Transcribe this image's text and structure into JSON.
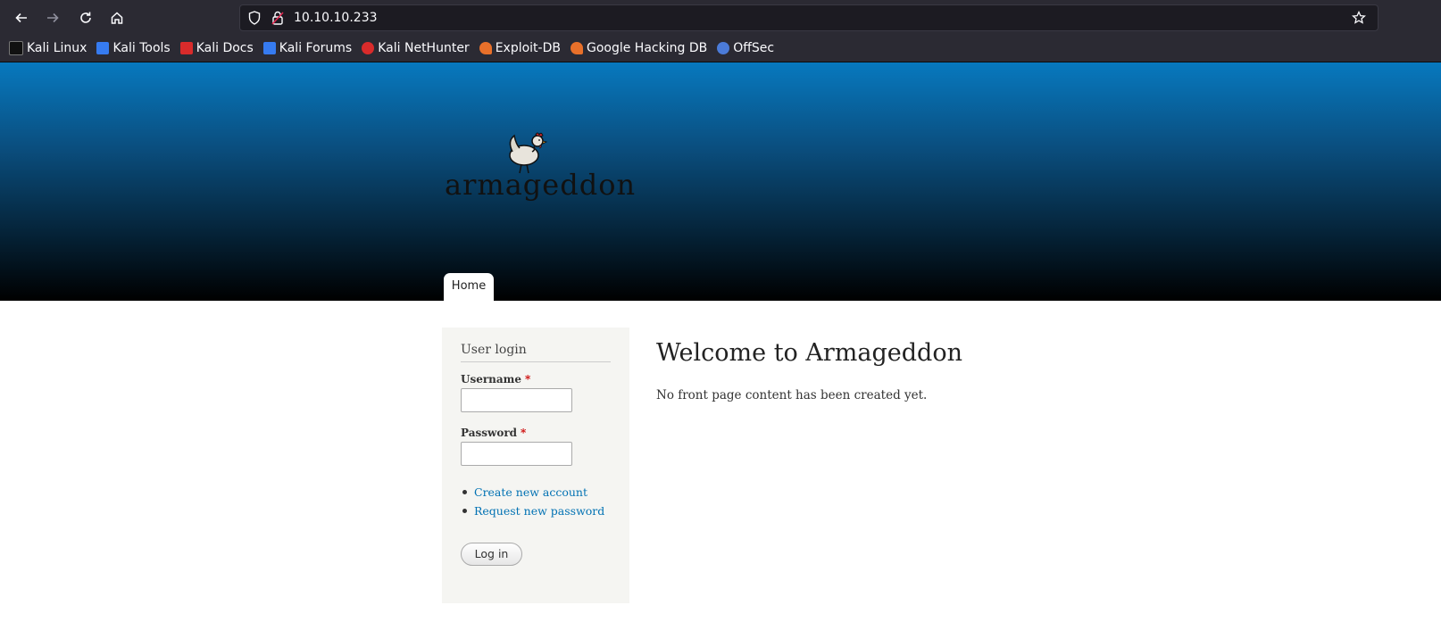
{
  "browser": {
    "url": "10.10.10.233",
    "bookmarks": [
      {
        "label": "Kali Linux",
        "color": "#2b2a33"
      },
      {
        "label": "Kali Tools",
        "color": "#367bf0"
      },
      {
        "label": "Kali Docs",
        "color": "#d92b2b"
      },
      {
        "label": "Kali Forums",
        "color": "#367bf0"
      },
      {
        "label": "Kali NetHunter",
        "color": "#d92b2b"
      },
      {
        "label": "Exploit-DB",
        "color": "#e8702a"
      },
      {
        "label": "Google Hacking DB",
        "color": "#e8702a"
      },
      {
        "label": "OffSec",
        "color": "#4b7bd8"
      }
    ]
  },
  "site": {
    "logo_text": "armageddon",
    "nav": {
      "home": "Home"
    }
  },
  "login": {
    "title": "User login",
    "username_label": "Username",
    "password_label": "Password",
    "required_mark": "*",
    "username_value": "",
    "password_value": "",
    "links": [
      "Create new account",
      "Request new password"
    ],
    "submit": "Log in"
  },
  "main": {
    "title": "Welcome to Armageddon",
    "text": "No front page content has been created yet."
  }
}
